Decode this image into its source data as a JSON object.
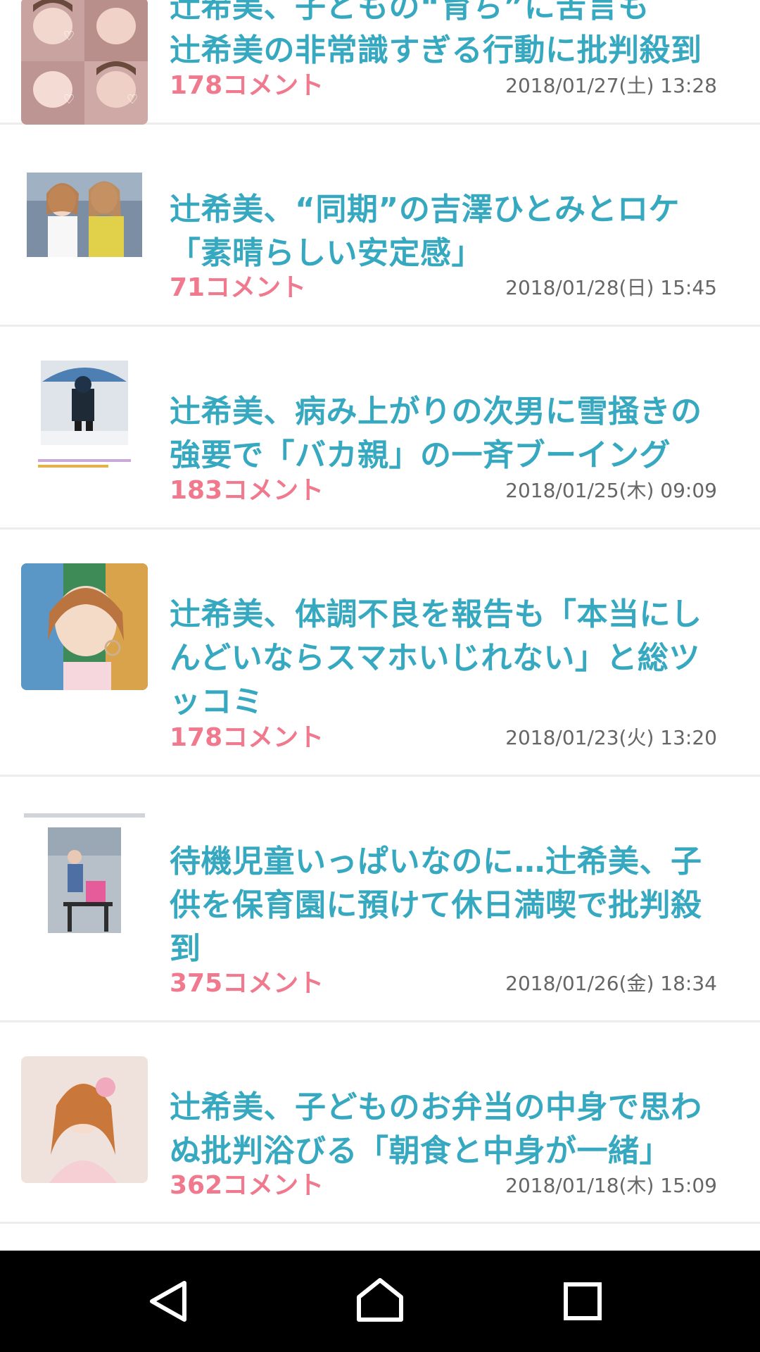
{
  "articles": [
    {
      "title": "辻希美、子どもの“育ち”に苦言も\n辻希美の非常識すぎる行動に批判殺到",
      "comments": "178コメント",
      "date": "2018/01/27(土) 13:28",
      "thumb": "selfie-collage"
    },
    {
      "title": "辻希美、“同期”の吉澤ひとみとロケ\n「素晴らしい安定感」",
      "comments": "71コメント",
      "date": "2018/01/28(日) 15:45",
      "thumb": "two-women-photo"
    },
    {
      "title": "辻希美、病み上がりの次男に雪掻きの\n強要で「バカ親」の一斉ブーイング",
      "comments": "183コメント",
      "date": "2018/01/25(木) 09:09",
      "thumb": "child-in-snow-screenshot"
    },
    {
      "title": "辻希美、体調不良を報告も「本当にし\nんどいならスマホいじれない」と総ツ\nッコミ",
      "comments": "178コメント",
      "date": "2018/01/23(火) 13:20",
      "thumb": "woman-portrait"
    },
    {
      "title": "待機児童いっぱいなのに…辻希美、子\n供を保育園に預けて休日満喫で批判殺\n到",
      "comments": "375コメント",
      "date": "2018/01/26(金) 18:34",
      "thumb": "gym-screenshot"
    },
    {
      "title": "辻希美、子どものお弁当の中身で思わ\nぬ批判浴びる「朝食と中身が一緒」",
      "comments": "362コメント",
      "date": "2018/01/18(木) 15:09",
      "thumb": "woman-pink-dress"
    }
  ],
  "nav": {
    "back": "back-triangle-icon",
    "home": "home-circle-icon",
    "recents": "recents-square-icon"
  },
  "colors": {
    "title": "#36a9c0",
    "comments": "#f0798e",
    "date": "#666666",
    "divider": "#ededed",
    "nav_background": "#000000"
  }
}
